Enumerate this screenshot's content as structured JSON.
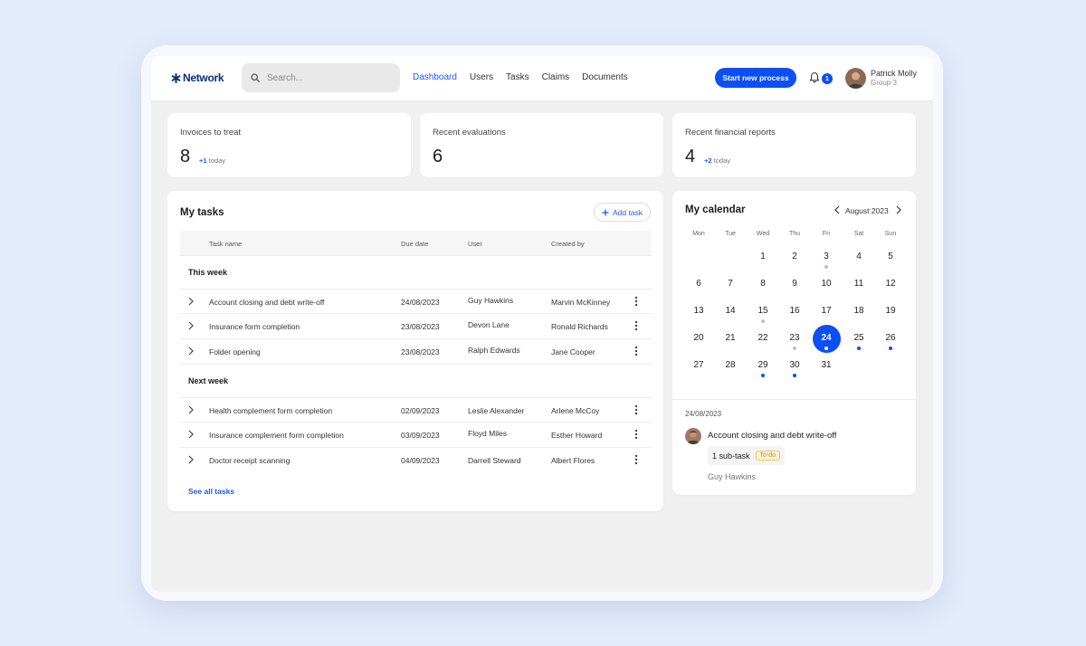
{
  "header": {
    "brand": "Network",
    "search_placeholder": "Search...",
    "nav": [
      "Dashboard",
      "Users",
      "Tasks",
      "Claims",
      "Documents"
    ],
    "nav_active_index": 0,
    "cta_label": "Start new process",
    "notifications_count": "1",
    "user": {
      "name": "Patrick Molly",
      "group": "Group 3"
    }
  },
  "stats": [
    {
      "title": "Invoices to treat",
      "value": "8",
      "delta": "+1",
      "delta_suffix": "today"
    },
    {
      "title": "Recent evaluations",
      "value": "6",
      "delta": "",
      "delta_suffix": ""
    },
    {
      "title": "Recent financial reports",
      "value": "4",
      "delta": "+2",
      "delta_suffix": "today"
    }
  ],
  "tasks": {
    "title": "My tasks",
    "add_label": "Add task",
    "columns": [
      "Task name",
      "Due date",
      "User",
      "Created by"
    ],
    "groups": [
      {
        "label": "This week",
        "rows": [
          {
            "name": "Account closing and debt write-off",
            "due": "24/08/2023",
            "user": "Guy Hawkins",
            "created_by": "Marvin McKinney"
          },
          {
            "name": "Insurance form completion",
            "due": "23/08/2023",
            "user": "Devon Lane",
            "created_by": "Ronald Richards"
          },
          {
            "name": "Folder opening",
            "due": "23/08/2023",
            "user": "Ralph Edwards",
            "created_by": "Jane Cooper"
          }
        ]
      },
      {
        "label": "Next week",
        "rows": [
          {
            "name": "Health complement form completion",
            "due": "02/09/2023",
            "user": "Leslie Alexander",
            "created_by": "Arlene McCoy"
          },
          {
            "name": "Insurance complement form completion",
            "due": "03/09/2023",
            "user": "Floyd Miles",
            "created_by": "Esther Howard"
          },
          {
            "name": "Doctor receipt scanning",
            "due": "04/09/2023",
            "user": "Darrell Steward",
            "created_by": "Albert Flores"
          }
        ]
      }
    ],
    "see_all": "See all tasks"
  },
  "calendar": {
    "title": "My calendar",
    "month_label": "August 2023",
    "weekdays": [
      "Mon",
      "Tue",
      "Wed",
      "Thu",
      "Fri",
      "Sat",
      "Sun"
    ],
    "weeks": [
      [
        "",
        "",
        "1",
        "2",
        "3",
        "4",
        "5"
      ],
      [
        "6",
        "7",
        "8",
        "9",
        "10",
        "11",
        "12"
      ],
      [
        "13",
        "14",
        "15",
        "16",
        "17",
        "18",
        "19"
      ],
      [
        "20",
        "21",
        "22",
        "23",
        "24",
        "25",
        "26"
      ],
      [
        "27",
        "28",
        "29",
        "30",
        "31",
        "",
        ""
      ]
    ],
    "selected_day": "24",
    "grey_dots": [
      "3",
      "15",
      "23"
    ],
    "blue_dots": [
      "24",
      "25",
      "26",
      "29",
      "30"
    ],
    "colors": {
      "accent": "#0b4ff5",
      "dot_grey": "#b9c0d8"
    },
    "event": {
      "date": "24/08/2023",
      "title": "Account closing and debt write-off",
      "subtask": "1 sub-task",
      "status": "To-do",
      "owner": "Guy Hawkins"
    }
  },
  "icons": [
    "network-logo-icon",
    "search-icon",
    "bell-icon",
    "chevron-right-icon",
    "kebab-menu-icon",
    "plus-icon",
    "chevron-left-icon"
  ]
}
